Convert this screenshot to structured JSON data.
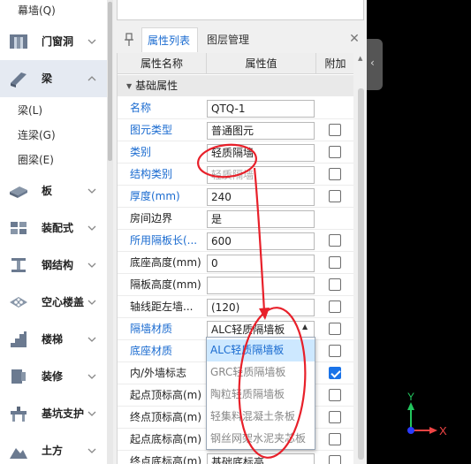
{
  "sidebar": {
    "sub_top": "幕墙(Q)",
    "categories": [
      {
        "label": "门窗洞",
        "icon": "door-window-icon"
      },
      {
        "label": "梁",
        "icon": "beam-icon"
      },
      {
        "label": "板",
        "icon": "slab-icon"
      },
      {
        "label": "装配式",
        "icon": "prefab-icon"
      },
      {
        "label": "钢结构",
        "icon": "steel-structure-icon"
      },
      {
        "label": "空心楼盖",
        "icon": "hollow-floor-icon"
      },
      {
        "label": "楼梯",
        "icon": "stair-icon"
      },
      {
        "label": "装修",
        "icon": "decoration-icon"
      },
      {
        "label": "基坑支护",
        "icon": "foundation-pit-icon"
      },
      {
        "label": "土方",
        "icon": "earthwork-icon"
      }
    ],
    "beam_sub_items": [
      "梁(L)",
      "连梁(G)",
      "圈梁(E)"
    ]
  },
  "panel": {
    "tabs": [
      {
        "label": "属性列表"
      },
      {
        "label": "图层管理"
      }
    ],
    "columns": {
      "name": "属性名称",
      "value": "属性值",
      "extra": "附加"
    },
    "group_label": "基础属性",
    "rows": [
      {
        "name": "名称",
        "value": "QTQ-1"
      },
      {
        "name": "图元类型",
        "value": "普通图元"
      },
      {
        "name": "类别",
        "value": "轻质隔墙"
      },
      {
        "name": "结构类别",
        "value": "轻质隔墙"
      },
      {
        "name": "厚度(mm)",
        "value": "240"
      },
      {
        "name": "房间边界",
        "value": "是"
      },
      {
        "name": "所用隔板长(...",
        "value": "600"
      },
      {
        "name": "底座高度(mm)",
        "value": "0"
      },
      {
        "name": "隔板高度(mm)",
        "value": ""
      },
      {
        "name": "轴线距左墙...",
        "value": "(120)"
      },
      {
        "name": "隔墙材质",
        "value": "ALC轻质隔墙板"
      },
      {
        "name": "底座材质",
        "value": ""
      },
      {
        "name": "内/外墙标志",
        "value": ""
      },
      {
        "name": "起点顶标高(m)",
        "value": ""
      },
      {
        "name": "终点顶标高(m)",
        "value": ""
      },
      {
        "name": "起点底标高(m)",
        "value": ""
      },
      {
        "name": "终点底标高(m)",
        "value": "基础底标高"
      }
    ],
    "dropdown_options": [
      "ALC轻质隔墙板",
      "GRC轻质隔墙板",
      "陶粒轻质隔墙板",
      "轻集料混凝土条板",
      "钢丝网架水泥夹芯板"
    ]
  },
  "axes_gizmo": {
    "y_label": "Y",
    "x_label": "X"
  },
  "colors": {
    "accent": "#1a6bd0",
    "annotation": "#e8202a",
    "axis_y": "#22c55e",
    "axis_x": "#ef4444",
    "axis_z": "#2b3bff"
  }
}
